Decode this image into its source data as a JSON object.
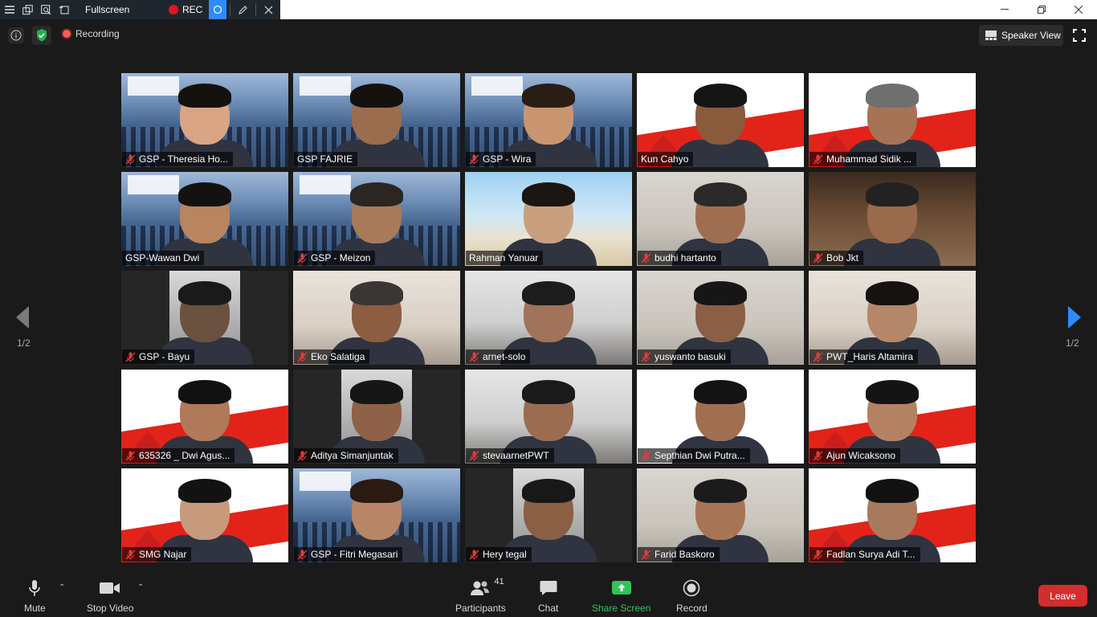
{
  "toolbar": {
    "fullscreen_label": "Fullscreen",
    "rec_label": "REC"
  },
  "header": {
    "recording_label": "Recording",
    "speaker_view_label": "Speaker View"
  },
  "pagination": {
    "left_label": "1/2",
    "right_label": "1/2"
  },
  "participants": [
    {
      "name": "GSP - Theresia Ho...",
      "muted": true,
      "bg": "gsp",
      "skin": "#d9a584",
      "hair": "#15110f",
      "active": false
    },
    {
      "name": "GSP FAJRIE",
      "muted": false,
      "bg": "gsp",
      "skin": "#9b6d4e",
      "hair": "#15110f",
      "active": false
    },
    {
      "name": "GSP - Wira",
      "muted": true,
      "bg": "gsp",
      "skin": "#c99570",
      "hair": "#2a1d14",
      "active": false
    },
    {
      "name": "Kun Cahyo",
      "muted": false,
      "bg": "upacara",
      "skin": "#8a5a3c",
      "hair": "#151515",
      "active": true
    },
    {
      "name": "Muhammad Sidik ...",
      "muted": true,
      "bg": "upacara",
      "skin": "#a77356",
      "hair": "#6f6f6f",
      "active": false
    },
    {
      "name": "GSP-Wawan Dwi",
      "muted": false,
      "bg": "gsp",
      "skin": "#b98460",
      "hair": "#141210",
      "active": false
    },
    {
      "name": "GSP - Meizon",
      "muted": true,
      "bg": "gsp",
      "skin": "#a87a5a",
      "hair": "#2b2622",
      "active": false
    },
    {
      "name": "Rahman Yanuar",
      "muted": false,
      "bg": "beach",
      "skin": "#c9a07f",
      "hair": "#1b1612",
      "active": false
    },
    {
      "name": "budhi hartanto",
      "muted": true,
      "bg": "room",
      "skin": "#9f6e51",
      "hair": "#2a2a2a",
      "active": false
    },
    {
      "name": "Bob Jkt",
      "muted": true,
      "bg": "lounge",
      "skin": "#9a6a4c",
      "hair": "#222",
      "active": false
    },
    {
      "name": "GSP - Bayu",
      "muted": true,
      "bg": "dark",
      "skin": "#6b5140",
      "hair": "#1a1a1a",
      "active": false
    },
    {
      "name": "Eko Salatiga",
      "muted": true,
      "bg": "warm",
      "skin": "#8c5d40",
      "hair": "#3a3634",
      "active": false
    },
    {
      "name": "arnet-solo",
      "muted": true,
      "bg": "office",
      "skin": "#a0735a",
      "hair": "#1c1c1c",
      "active": false
    },
    {
      "name": "yuswanto basuki",
      "muted": true,
      "bg": "room",
      "skin": "#8a5f45",
      "hair": "#161616",
      "active": false
    },
    {
      "name": "PWT_Haris Altamira",
      "muted": true,
      "bg": "warm",
      "skin": "#b4876a",
      "hair": "#151210",
      "active": false
    },
    {
      "name": "635326 _ Dwi Agus...",
      "muted": true,
      "bg": "upacara",
      "skin": "#b07a5a",
      "hair": "#111",
      "active": false
    },
    {
      "name": "Aditya Simanjuntak",
      "muted": true,
      "bg": "dark",
      "skin": "#8e6148",
      "hair": "#161616",
      "active": false
    },
    {
      "name": "stevaarnetPWT",
      "muted": true,
      "bg": "office",
      "skin": "#9a6d50",
      "hair": "#1a1a1a",
      "active": false
    },
    {
      "name": "Septhian Dwi Putra...",
      "muted": true,
      "bg": "akhlak",
      "skin": "#a06f52",
      "hair": "#141414",
      "active": false
    },
    {
      "name": "Ajun Wicaksono",
      "muted": true,
      "bg": "upacara",
      "skin": "#b38262",
      "hair": "#141414",
      "active": false
    },
    {
      "name": "SMG Najar",
      "muted": true,
      "bg": "upacara",
      "skin": "#c79a7b",
      "hair": "#121212",
      "active": false
    },
    {
      "name": "GSP - Fitri Megasari",
      "muted": true,
      "bg": "gsp",
      "skin": "#b88666",
      "hair": "#2a1a12",
      "active": false
    },
    {
      "name": "Hery tegal",
      "muted": true,
      "bg": "dark",
      "skin": "#8b5f44",
      "hair": "#181818",
      "active": false
    },
    {
      "name": "Farid Baskoro",
      "muted": true,
      "bg": "room",
      "skin": "#a77555",
      "hair": "#1b1b1b",
      "active": false
    },
    {
      "name": "Fadlan Surya Adi T...",
      "muted": true,
      "bg": "upacara",
      "skin": "#a77a5e",
      "hair": "#111",
      "active": false
    }
  ],
  "bottom_toolbar": {
    "mute_label": "Mute",
    "video_label": "Stop Video",
    "participants_label": "Participants",
    "participants_count": "41",
    "chat_label": "Chat",
    "share_label": "Share Screen",
    "record_label": "Record",
    "leave_label": "Leave"
  },
  "colors": {
    "accent_blue": "#2d8cff",
    "active_speaker": "#c6f04b",
    "share_green": "#33c35a",
    "leave_red": "#d32d2d",
    "rec_red": "#e81123"
  }
}
